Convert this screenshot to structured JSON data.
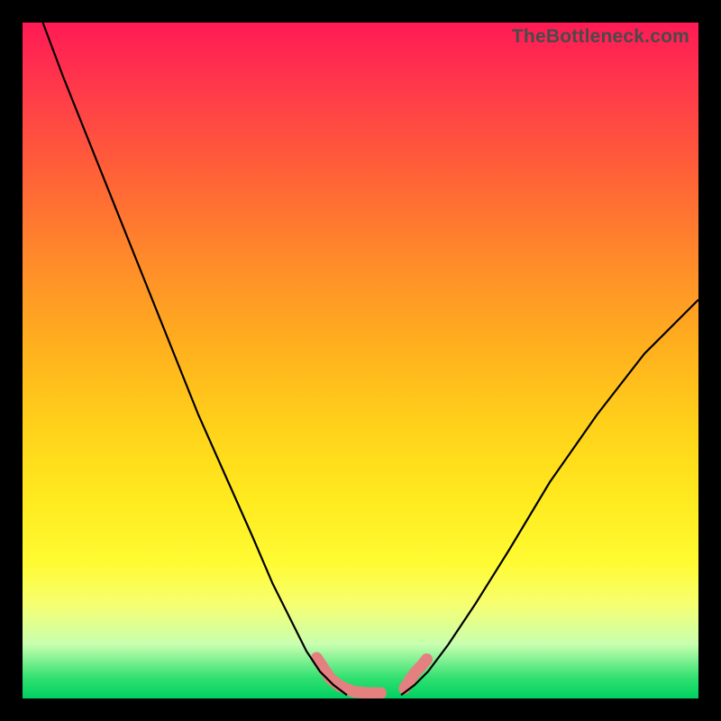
{
  "watermark": "TheBottleneck.com",
  "chart_data": {
    "type": "line",
    "title": "",
    "xlabel": "",
    "ylabel": "",
    "x_range": [
      0,
      100
    ],
    "y_range": [
      0,
      100
    ],
    "left_curve": {
      "x": [
        3,
        6,
        10,
        14,
        18,
        22,
        26,
        30,
        34,
        37,
        40,
        42,
        44,
        46,
        48
      ],
      "y": [
        100,
        92,
        82,
        72,
        62,
        52,
        42,
        33,
        24,
        17,
        11,
        7,
        4,
        2,
        0.5
      ]
    },
    "right_curve": {
      "x": [
        56,
        58,
        60,
        63,
        67,
        72,
        78,
        85,
        92,
        100
      ],
      "y": [
        0.5,
        2,
        4,
        8,
        14,
        22,
        32,
        42,
        51,
        59
      ]
    },
    "bumps_left": {
      "x": [
        43.5,
        44.5,
        45.5,
        47.0,
        49.0,
        51.0,
        53.0
      ],
      "y": [
        6.0,
        4.5,
        3.0,
        1.8,
        1.0,
        0.8,
        0.8
      ]
    },
    "bumps_right": {
      "x": [
        56.5,
        57.5,
        58.2,
        59.0,
        59.8
      ],
      "y": [
        1.5,
        3.0,
        4.0,
        4.8,
        5.8
      ]
    },
    "background_gradient": {
      "stops": [
        {
          "pos": 0,
          "color": "#ff1a55"
        },
        {
          "pos": 35,
          "color": "#ff8a2a"
        },
        {
          "pos": 70,
          "color": "#ffe91e"
        },
        {
          "pos": 100,
          "color": "#00d060"
        }
      ]
    }
  }
}
